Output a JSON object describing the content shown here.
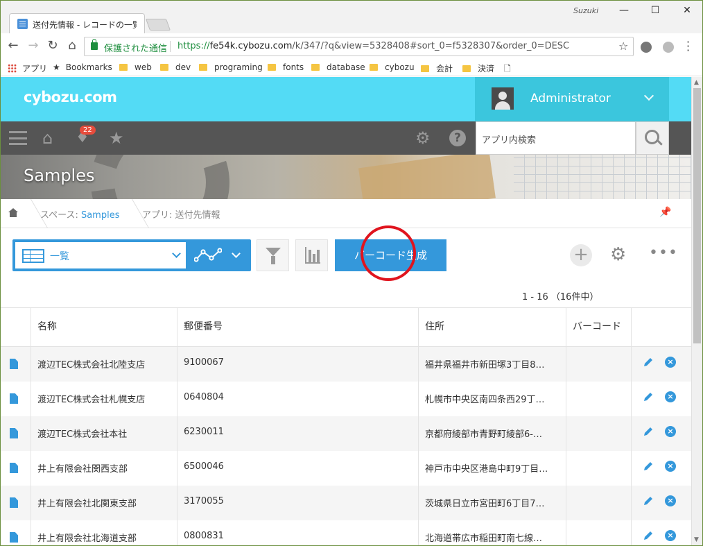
{
  "browser": {
    "tab_title": "送付先情報 - レコードの一覧",
    "user": "Suzuki",
    "secure_label": "保護された通信",
    "url_scheme": "https://",
    "url_host": "fe54k.cybozu.com",
    "url_path": "/k/347/?q&view=5328408#sort_0=f5328307&order_0=DESC",
    "bookmarks": [
      "アプリ",
      "Bookmarks",
      "web",
      "dev",
      "programing",
      "fonts",
      "database",
      "cybozu",
      "会計",
      "決済"
    ]
  },
  "header": {
    "logo": "cybozu.com",
    "user_name": "Administrator",
    "notification_count": "22",
    "search_placeholder": "アプリ内検索"
  },
  "banner": {
    "title": "Samples"
  },
  "breadcrumb": {
    "space_prefix": "スペース: ",
    "space_name": "Samples",
    "app_label": "アプリ: 送付先情報"
  },
  "actions": {
    "view_label": "一覧",
    "barcode_button": "バーコード生成",
    "pager": "1 - 16 （16件中）"
  },
  "table": {
    "columns": [
      "名称",
      "郵便番号",
      "住所",
      "バーコード"
    ],
    "rows": [
      {
        "name": "渡辺TEC株式会社北陸支店",
        "zip": "9100067",
        "address": "福井県福井市新田塚3丁目8…",
        "barcode": ""
      },
      {
        "name": "渡辺TEC株式会社札幌支店",
        "zip": "0640804",
        "address": "札幌市中央区南四条西29丁…",
        "barcode": ""
      },
      {
        "name": "渡辺TEC株式会社本社",
        "zip": "6230011",
        "address": "京都府綾部市青野町綾部6-…",
        "barcode": ""
      },
      {
        "name": "井上有限会社関西支部",
        "zip": "6500046",
        "address": "神戸市中央区港島中町9丁目…",
        "barcode": ""
      },
      {
        "name": "井上有限会社北関東支部",
        "zip": "3170055",
        "address": "茨城県日立市宮田町6丁目7…",
        "barcode": ""
      },
      {
        "name": "井上有限会社北海道支部",
        "zip": "0800831",
        "address": "北海道帯広市稲田町南七線…",
        "barcode": ""
      }
    ]
  },
  "colors": {
    "header": "#53dbf5",
    "accent": "#3498db",
    "navbar": "#555555",
    "highlight_circle": "#e0141e"
  }
}
